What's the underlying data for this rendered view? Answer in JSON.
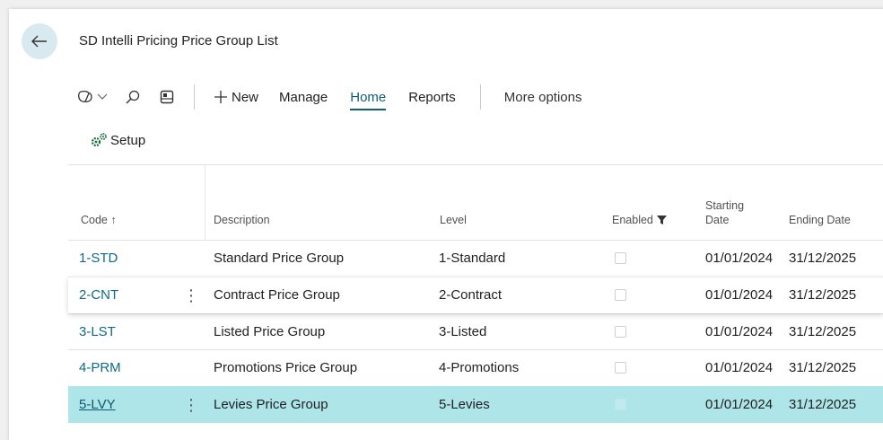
{
  "page": {
    "title": "SD Intelli Pricing Price Group List"
  },
  "toolbar": {
    "new_label": "New",
    "manage_label": "Manage",
    "home_label": "Home",
    "reports_label": "Reports",
    "more_options_label": "More options",
    "active_tab": "Home"
  },
  "actions": {
    "setup_label": "Setup"
  },
  "table": {
    "headers": {
      "code": "Code",
      "sort_indicator": "↑",
      "description": "Description",
      "level": "Level",
      "enabled": "Enabled",
      "starting_date_line1": "Starting",
      "starting_date_line2": "Date",
      "ending_date": "Ending Date"
    },
    "rows": [
      {
        "code": "1-STD",
        "description": "Standard Price Group",
        "level": "1-Standard",
        "enabled": false,
        "starting_date": "01/01/2024",
        "ending_date": "31/12/2025"
      },
      {
        "code": "2-CNT",
        "description": "Contract Price Group",
        "level": "2-Contract",
        "enabled": false,
        "starting_date": "01/01/2024",
        "ending_date": "31/12/2025"
      },
      {
        "code": "3-LST",
        "description": "Listed Price Group",
        "level": "3-Listed",
        "enabled": false,
        "starting_date": "01/01/2024",
        "ending_date": "31/12/2025"
      },
      {
        "code": "4-PRM",
        "description": "Promotions Price Group",
        "level": "4-Promotions",
        "enabled": false,
        "starting_date": "01/01/2024",
        "ending_date": "31/12/2025"
      },
      {
        "code": "5-LVY",
        "description": "Levies Price Group",
        "level": "5-Levies",
        "enabled": false,
        "starting_date": "01/01/2024",
        "ending_date": "31/12/2025"
      }
    ]
  },
  "colors": {
    "accent": "#0f6a85",
    "selected_row": "#aee5e9",
    "back_button_bg": "#d8e9ef"
  },
  "icons": {
    "back": "arrow-left-icon",
    "copilot": "copilot-icon",
    "search": "search-icon",
    "layout": "layout-icon",
    "new": "plus-icon",
    "setup": "gears-icon",
    "filter": "filter-icon"
  }
}
